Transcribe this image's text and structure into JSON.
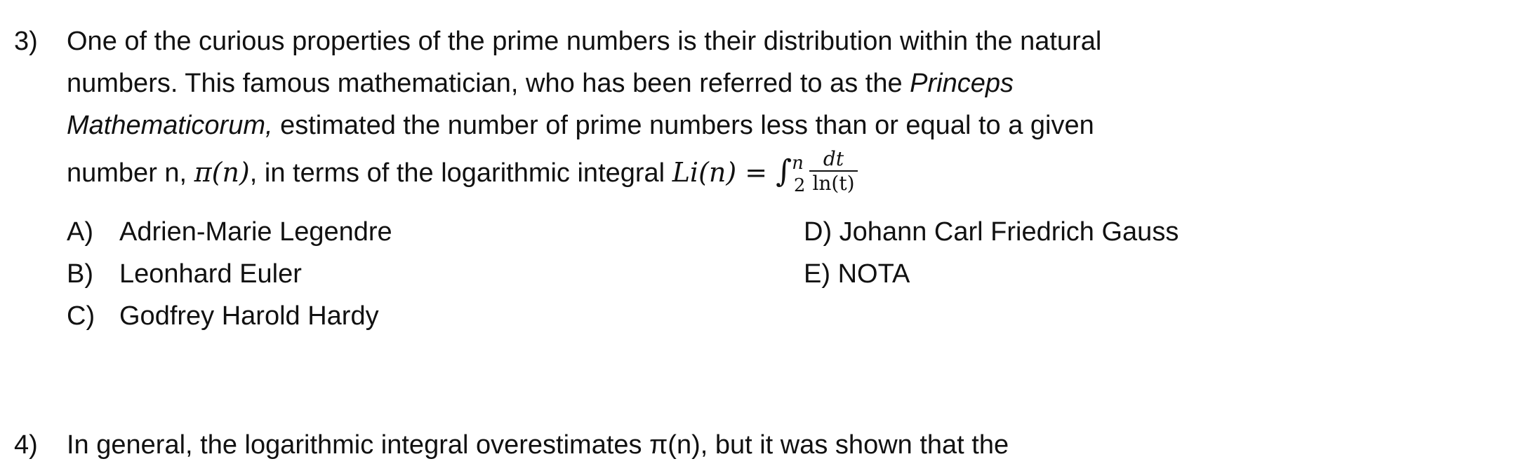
{
  "question3": {
    "number": "3)",
    "line1": "One of the curious properties of the prime numbers is their distribution within the natural",
    "line2_pre": "numbers. This famous mathematician, who has been referred to as the ",
    "line2_italic": "Princeps",
    "line3_italic": "Mathematicorum,",
    "line3_post": " estimated the number of prime numbers less than or equal to a given",
    "line4_pre": "number n, ",
    "line4_pi": "π(n)",
    "line4_mid": ", in terms of the logarithmic integral ",
    "formula": {
      "lhs": "Li(n) = ",
      "integral": "∫",
      "upper": "n",
      "lower": "2",
      "numerator": "dt",
      "denominator": "ln(t)"
    },
    "choices": [
      {
        "letter": "A)",
        "text": "Adrien-Marie Legendre"
      },
      {
        "letter": "B)",
        "text": "Leonhard Euler"
      },
      {
        "letter": "C)",
        "text": "Godfrey Harold Hardy"
      },
      {
        "letter": "D)",
        "text": "Johann Carl Friedrich Gauss"
      },
      {
        "letter": "E)",
        "text": "NOTA"
      }
    ]
  },
  "question4": {
    "number": "4)",
    "line1": "In general, the logarithmic integral overestimates π(n), but it was shown that the"
  }
}
